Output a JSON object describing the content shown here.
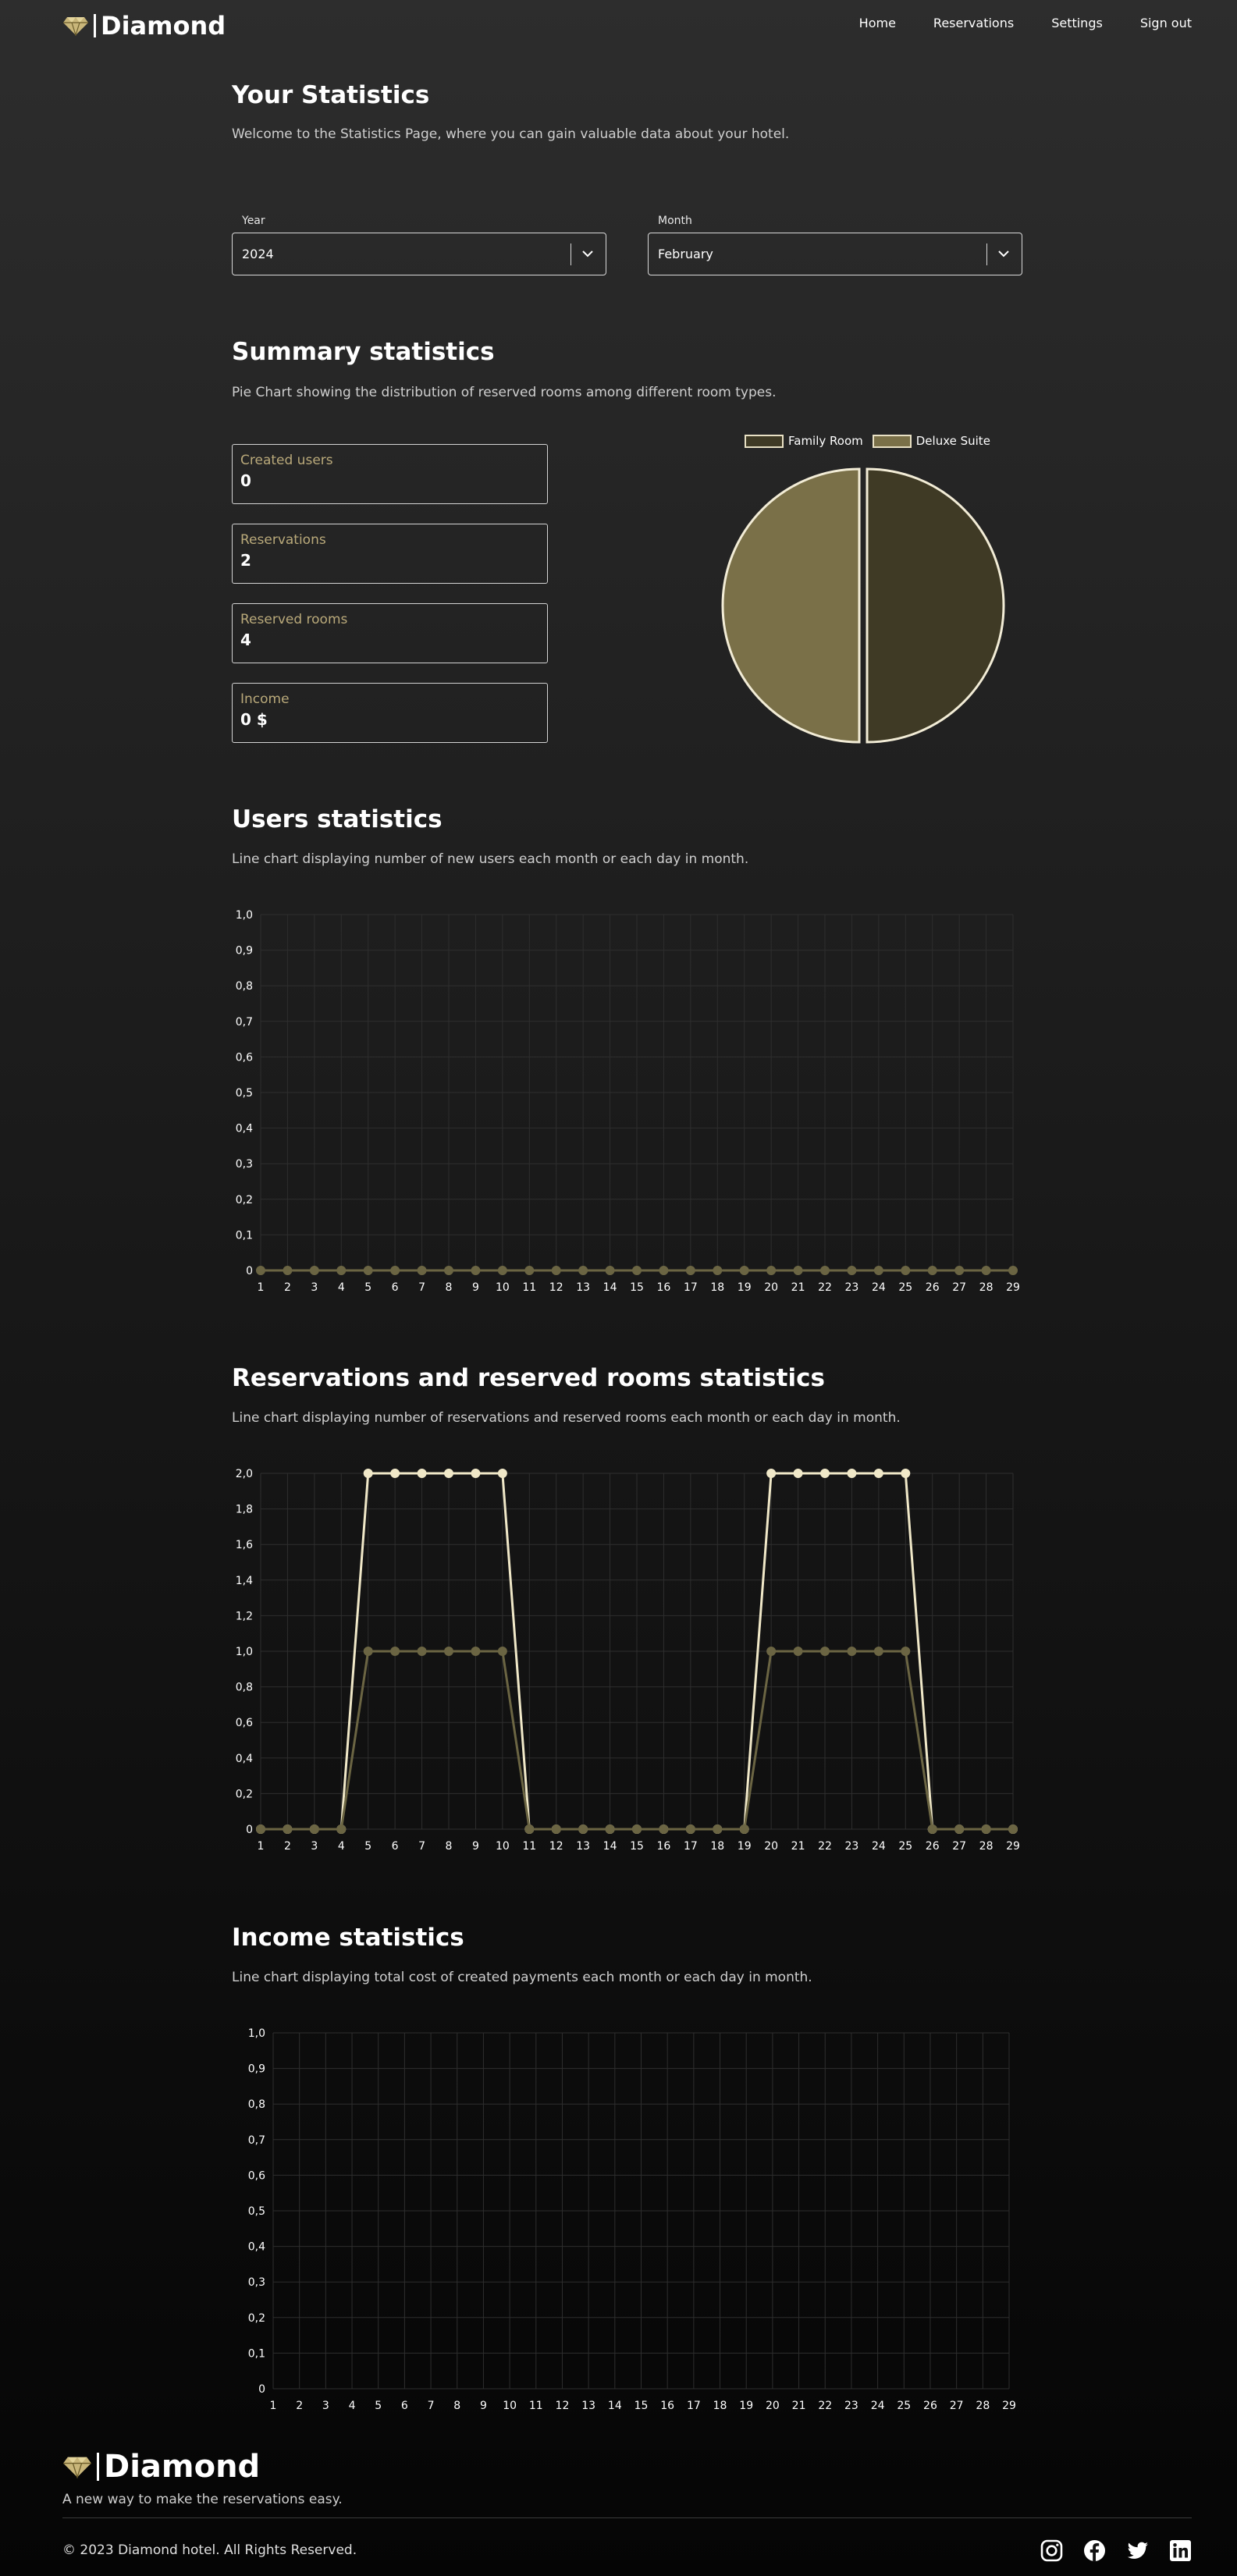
{
  "brand": {
    "name": "Diamond"
  },
  "nav": {
    "home": "Home",
    "reservations": "Reservations",
    "settings": "Settings",
    "sign_out": "Sign out"
  },
  "intro": {
    "title": "Your Statistics",
    "description": "Welcome to the Statistics Page, where you can gain valuable data about your hotel."
  },
  "filters": {
    "year_label": "Year",
    "year_value": "2024",
    "month_label": "Month",
    "month_value": "February"
  },
  "summary": {
    "title": "Summary statistics",
    "description": "Pie Chart showing the distribution of reserved rooms among different room types.",
    "stats": [
      {
        "label": "Created users",
        "value": "0"
      },
      {
        "label": "Reservations",
        "value": "2"
      },
      {
        "label": "Reserved rooms",
        "value": "4"
      },
      {
        "label": "Income",
        "value": "0 $"
      }
    ]
  },
  "users": {
    "title": "Users statistics",
    "description": "Line chart displaying number of new users each month or each day in month."
  },
  "reservations": {
    "title": "Reservations and reserved rooms statistics",
    "description": "Line chart displaying number of reservations and reserved rooms each month or each day in month."
  },
  "income": {
    "title": "Income statistics",
    "description": "Line chart displaying total cost of created payments each month or each day in month."
  },
  "footer": {
    "tagline": "A new way to make the reservations easy.",
    "copyright": "© 2023 Diamond hotel. All Rights Reserved.",
    "socials": [
      "instagram-icon",
      "facebook-icon",
      "twitter-icon",
      "linkedin-icon"
    ]
  },
  "colors": {
    "accent_gold": "#b9a97a",
    "pie_dark": "#3f3a25",
    "pie_light": "#7a7048",
    "line_light": "#f0e8c8",
    "line_dark": "#6b6543"
  },
  "chart_data": [
    {
      "type": "pie",
      "title": "",
      "legend": [
        "Family Room",
        "Deluxe Suite"
      ],
      "values": [
        2,
        2
      ],
      "legend_position": "top"
    },
    {
      "type": "line",
      "title": "",
      "x": [
        "1",
        "2",
        "3",
        "4",
        "5",
        "6",
        "7",
        "8",
        "9",
        "10",
        "11",
        "12",
        "13",
        "14",
        "15",
        "16",
        "17",
        "18",
        "19",
        "20",
        "21",
        "22",
        "23",
        "24",
        "25",
        "26",
        "27",
        "28",
        "29"
      ],
      "yticks": [
        "0",
        "0,1",
        "0,2",
        "0,3",
        "0,4",
        "0,5",
        "0,6",
        "0,7",
        "0,8",
        "0,9",
        "1,0"
      ],
      "ylim": [
        0,
        1
      ],
      "series": [
        {
          "values": [
            0,
            0,
            0,
            0,
            0,
            0,
            0,
            0,
            0,
            0,
            0,
            0,
            0,
            0,
            0,
            0,
            0,
            0,
            0,
            0,
            0,
            0,
            0,
            0,
            0,
            0,
            0,
            0,
            0
          ]
        }
      ],
      "grid": true
    },
    {
      "type": "line",
      "title": "",
      "x": [
        "1",
        "2",
        "3",
        "4",
        "5",
        "6",
        "7",
        "8",
        "9",
        "10",
        "11",
        "12",
        "13",
        "14",
        "15",
        "16",
        "17",
        "18",
        "19",
        "20",
        "21",
        "22",
        "23",
        "24",
        "25",
        "26",
        "27",
        "28",
        "29"
      ],
      "yticks": [
        "0",
        "0,2",
        "0,4",
        "0,6",
        "0,8",
        "1,0",
        "1,2",
        "1,4",
        "1,6",
        "1,8",
        "2,0"
      ],
      "ylim": [
        0,
        2
      ],
      "series": [
        {
          "values": [
            0,
            0,
            0,
            0,
            2,
            2,
            2,
            2,
            2,
            2,
            0,
            0,
            0,
            0,
            0,
            0,
            0,
            0,
            0,
            2,
            2,
            2,
            2,
            2,
            2,
            0,
            0,
            0,
            0
          ]
        },
        {
          "values": [
            0,
            0,
            0,
            0,
            1,
            1,
            1,
            1,
            1,
            1,
            0,
            0,
            0,
            0,
            0,
            0,
            0,
            0,
            0,
            1,
            1,
            1,
            1,
            1,
            1,
            0,
            0,
            0,
            0
          ]
        }
      ],
      "grid": true
    },
    {
      "type": "line",
      "title": "",
      "x": [
        "1",
        "2",
        "3",
        "4",
        "5",
        "6",
        "7",
        "8",
        "9",
        "10",
        "11",
        "12",
        "13",
        "14",
        "15",
        "16",
        "17",
        "18",
        "19",
        "20",
        "21",
        "22",
        "23",
        "24",
        "25",
        "26",
        "27",
        "28",
        "29"
      ],
      "yticks": [
        "0",
        "0,1",
        "0,2",
        "0,3",
        "0,4",
        "0,5",
        "0,6",
        "0,7",
        "0,8",
        "0,9",
        "1,0"
      ],
      "ylim": [
        0,
        1
      ],
      "series": [],
      "grid": true
    }
  ]
}
